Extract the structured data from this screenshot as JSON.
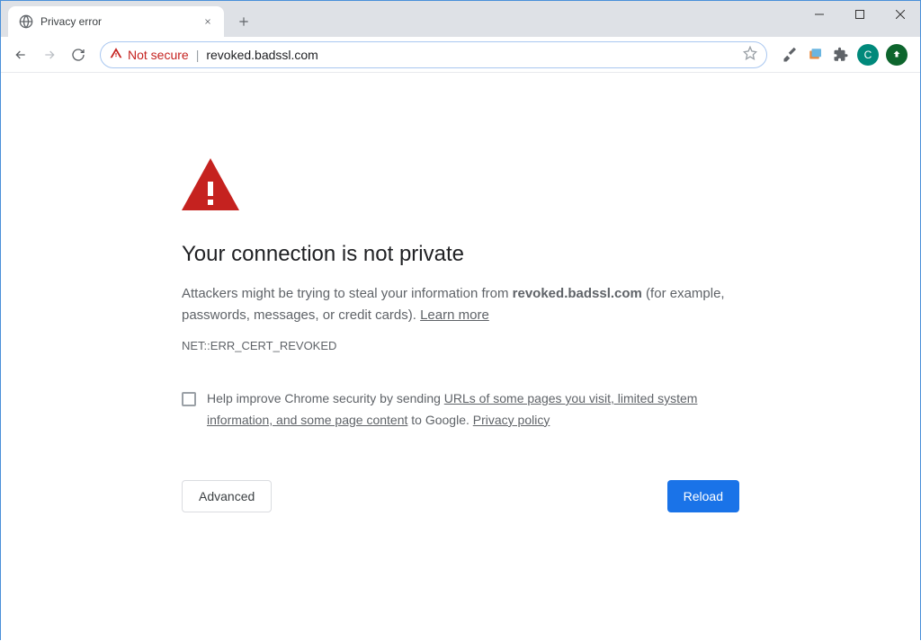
{
  "window": {
    "active_tab_title": "Privacy error"
  },
  "toolbar": {
    "security_label": "Not secure",
    "url": "revoked.badssl.com",
    "avatar_letter": "C"
  },
  "interstitial": {
    "heading": "Your connection is not private",
    "body_pre": "Attackers might be trying to steal your information from ",
    "body_host": "revoked.badssl.com",
    "body_post": " (for example, passwords, messages, or credit cards). ",
    "learn_more": "Learn more",
    "error_code": "NET::ERR_CERT_REVOKED",
    "opt_in_pre": "Help improve Chrome security by sending ",
    "opt_in_link1": "URLs of some pages you visit, limited system information, and some page content",
    "opt_in_mid": " to Google. ",
    "opt_in_link2": "Privacy policy",
    "advanced_label": "Advanced",
    "reload_label": "Reload"
  }
}
